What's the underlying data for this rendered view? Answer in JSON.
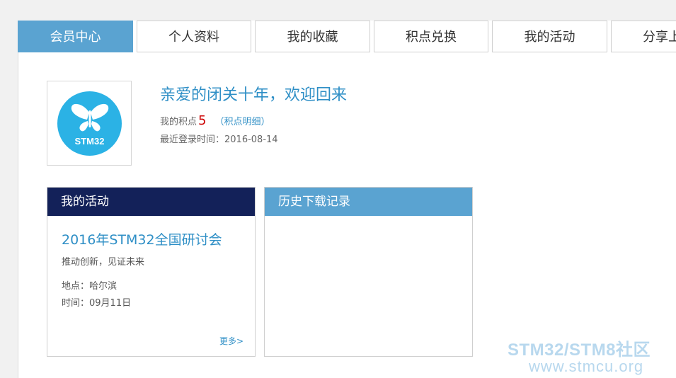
{
  "tabs": [
    {
      "label": "会员中心",
      "active": true
    },
    {
      "label": "个人资料",
      "active": false
    },
    {
      "label": "我的收藏",
      "active": false
    },
    {
      "label": "积点兑换",
      "active": false
    },
    {
      "label": "我的活动",
      "active": false
    },
    {
      "label": "分享上",
      "active": false
    }
  ],
  "profile": {
    "avatar_text": "STM32",
    "welcome": "亲爱的闭关十年，欢迎回来",
    "points_label": "我的积点",
    "points_value": "5",
    "points_link": "（积点明细）",
    "last_login": "最近登录时间：2016-08-14"
  },
  "activity_panel": {
    "title": "我的活动",
    "event_title": "2016年STM32全国研讨会",
    "event_subtitle": "推动创新，见证未来",
    "place": "地点：哈尔滨",
    "time": "时间：09月11日",
    "more": "更多>"
  },
  "history_panel": {
    "title": "历史下载记录"
  },
  "watermark": {
    "line1": "STM32/STM8社区",
    "line2": "www.stmcu.org"
  },
  "colors": {
    "accent": "#5aa3d1",
    "navy": "#132159",
    "link": "#2f8fc6",
    "points": "#cc0000",
    "logo": "#2bb2e5"
  }
}
